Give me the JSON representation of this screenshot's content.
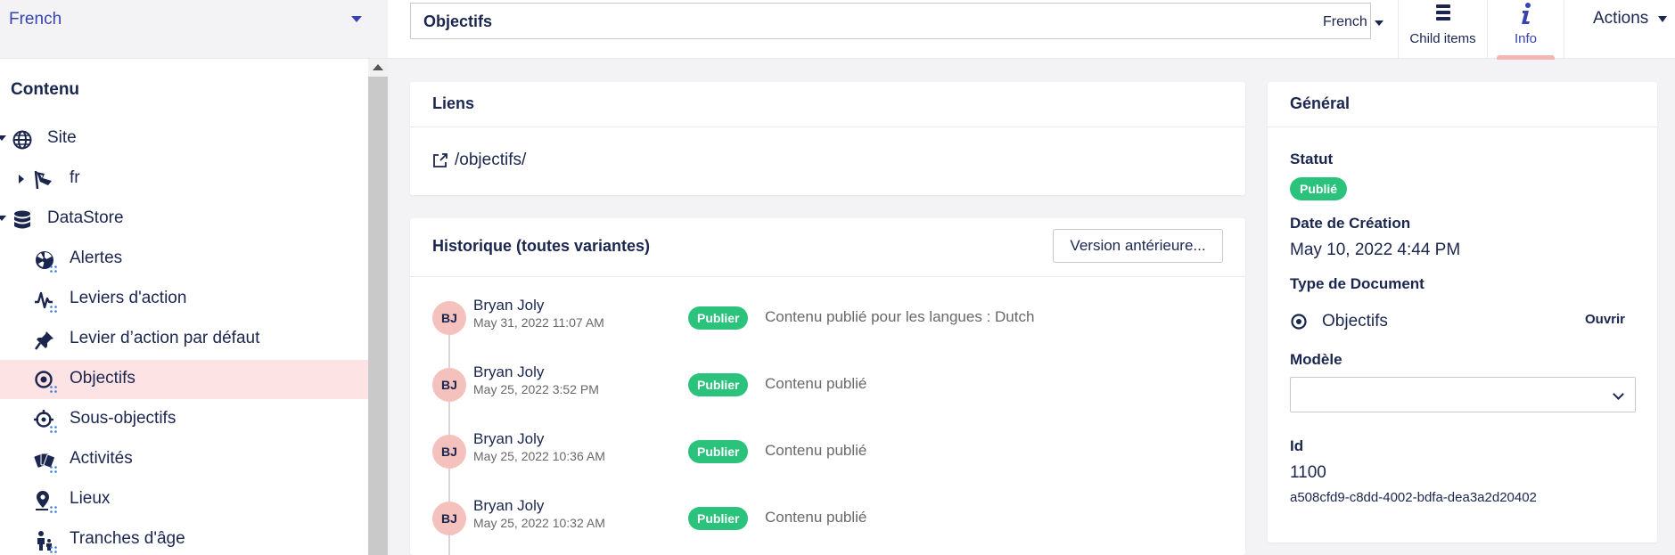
{
  "sidebar": {
    "language": "French",
    "section_title": "Contenu",
    "items": [
      {
        "label": "Site",
        "icon": "globe-icon"
      },
      {
        "label": "fr",
        "icon": "flag-icon"
      },
      {
        "label": "DataStore",
        "icon": "database-icon"
      },
      {
        "label": "Alertes",
        "icon": "alert-radiation-icon"
      },
      {
        "label": "Leviers d'action",
        "icon": "activity-icon"
      },
      {
        "label": "Levier d’action par défaut",
        "icon": "pin-icon"
      },
      {
        "label": "Objectifs",
        "icon": "target-icon"
      },
      {
        "label": "Sous-objectifs",
        "icon": "subtarget-icon"
      },
      {
        "label": "Activités",
        "icon": "cards-icon"
      },
      {
        "label": "Lieux",
        "icon": "location-icon"
      },
      {
        "label": "Tranches d'âge",
        "icon": "person-child-icon"
      }
    ]
  },
  "header": {
    "node_name": "Objectifs",
    "variant_language": "French",
    "child_items_label": "Child items",
    "info_label": "Info",
    "actions_label": "Actions"
  },
  "links_card": {
    "title": "Liens",
    "url": "/objectifs/"
  },
  "history_card": {
    "title": "Historique (toutes variantes)",
    "button_label": "Version antérieure...",
    "entries": [
      {
        "initials": "BJ",
        "user": "Bryan Joly",
        "date": "May 31, 2022 11:07 AM",
        "badge": "Publier",
        "message": "Contenu publié pour les langues : Dutch"
      },
      {
        "initials": "BJ",
        "user": "Bryan Joly",
        "date": "May 25, 2022 3:52 PM",
        "badge": "Publier",
        "message": "Contenu publié"
      },
      {
        "initials": "BJ",
        "user": "Bryan Joly",
        "date": "May 25, 2022 10:36 AM",
        "badge": "Publier",
        "message": "Contenu publié"
      },
      {
        "initials": "BJ",
        "user": "Bryan Joly",
        "date": "May 25, 2022 10:32 AM",
        "badge": "Publier",
        "message": "Contenu publié"
      }
    ]
  },
  "general_card": {
    "title": "Général",
    "status_label": "Statut",
    "status_value": "Publié",
    "created_label": "Date de Création",
    "created_value": "May 10, 2022 4:44 PM",
    "doctype_label": "Type de Document",
    "doctype_value": "Objectifs",
    "open_label": "Ouvrir",
    "template_label": "Modèle",
    "template_value": "",
    "id_label": "Id",
    "id_value": "1100",
    "guid_value": "a508cfd9-c8dd-4002-bdfa-dea3a2d20402"
  },
  "colors": {
    "accent": "#3544b1",
    "navy": "#1b264f",
    "active_bg": "#fde3e3",
    "badge_green": "#2bc37c",
    "avatar_pink": "#f5c1bd"
  }
}
